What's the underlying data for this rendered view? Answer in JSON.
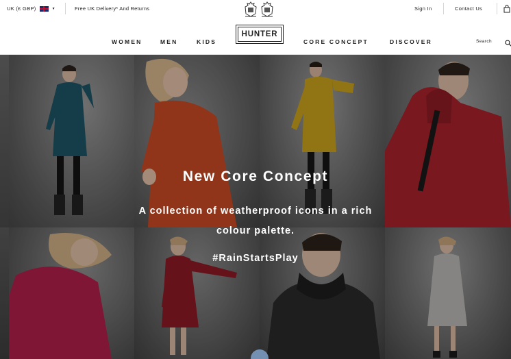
{
  "topbar": {
    "locale": "UK (£ GBP)",
    "delivery": "Free UK Delivery* And Returns",
    "sign_in": "Sign In",
    "contact_us": "Contact Us"
  },
  "nav": {
    "items": [
      "WOMEN",
      "MEN",
      "KIDS",
      "CORE CONCEPT",
      "DISCOVER"
    ],
    "logo": "HUNTER",
    "search_label": "Search"
  },
  "hero": {
    "title": "New Core Concept",
    "subtitle_line1": "A collection of weatherproof icons in a rich",
    "subtitle_line2": "colour palette.",
    "hashtag": "#RainStartsPlay"
  },
  "colors": {
    "teal_coat": "#1d5566",
    "orange_coat": "#c84a25",
    "yellow_coat": "#c9a11c",
    "red_coat": "#a8232b",
    "pink_coat": "#b21f4a",
    "dark_red_coat": "#8c1a24",
    "black_coat": "#2a2a2a",
    "grey_coat": "#b9b8b4"
  },
  "icons": [
    "uk-flag-icon",
    "chevron-down-icon",
    "royal-warrant-icon",
    "search-icon",
    "shopping-bag-icon"
  ]
}
